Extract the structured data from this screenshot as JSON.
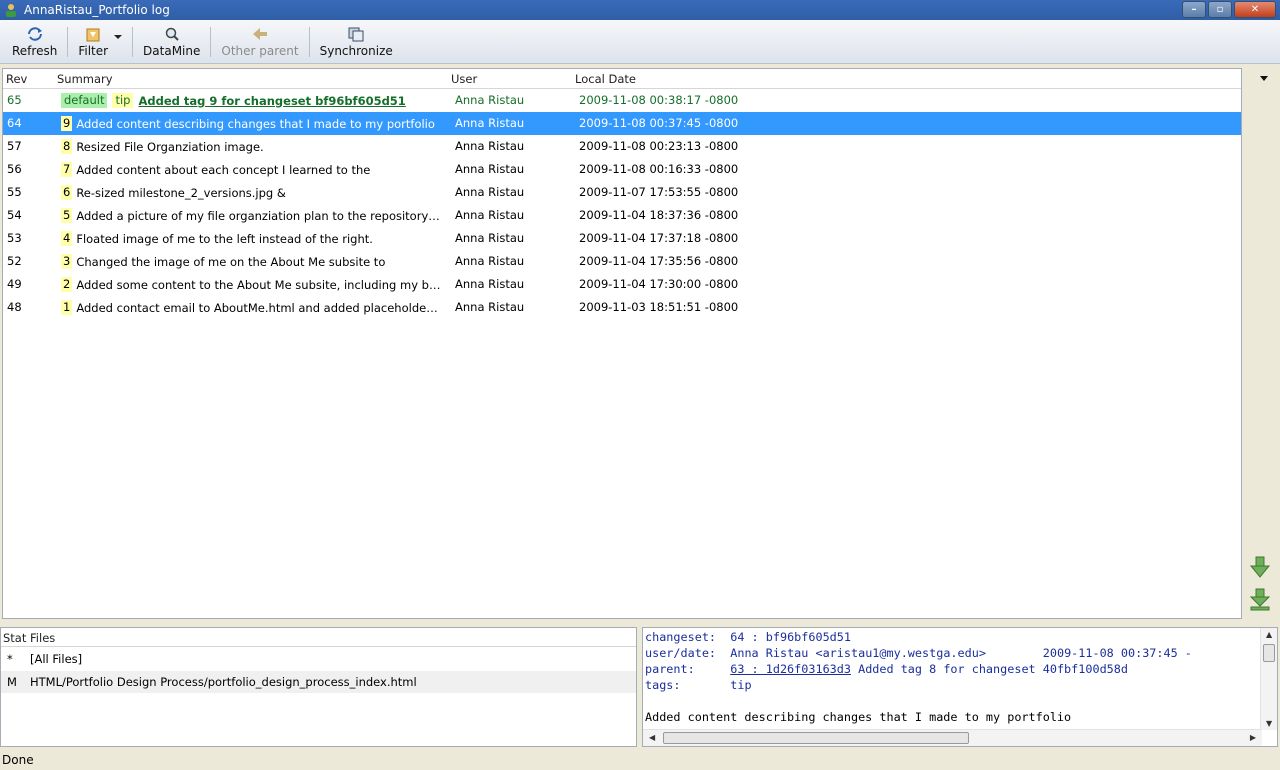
{
  "window": {
    "title": "AnnaRistau_Portfolio log",
    "minimize_icon": "minimize-icon",
    "maximize_icon": "maximize-icon",
    "close_icon": "close-icon"
  },
  "toolbar": {
    "refresh_label": "Refresh",
    "filter_label": "Filter",
    "datamine_label": "DataMine",
    "other_parent_label": "Other parent",
    "synchronize_label": "Synchronize"
  },
  "log": {
    "headers": {
      "rev": "Rev",
      "summary": "Summary",
      "user": "User",
      "date": "Local Date"
    },
    "rows": [
      {
        "rev": "65",
        "branch": "default",
        "tag": "tip",
        "summary": "Added tag 9 for changeset bf96bf605d51",
        "user": "Anna Ristau",
        "date": "2009-11-08 00:38:17 -0800"
      },
      {
        "rev": "64",
        "badge": "9",
        "summary": "Added content describing changes that I made to my portfolio",
        "user": "Anna Ristau",
        "date": "2009-11-08 00:37:45 -0800"
      },
      {
        "rev": "57",
        "badge": "8",
        "summary": "Resized File Organziation image.",
        "user": "Anna Ristau",
        "date": "2009-11-08 00:23:13 -0800"
      },
      {
        "rev": "56",
        "badge": "7",
        "summary": "Added content about each concept I learned to the",
        "user": "Anna Ristau",
        "date": "2009-11-08 00:16:33 -0800"
      },
      {
        "rev": "55",
        "badge": "6",
        "summary": "Re-sized milestone_2_versions.jpg &",
        "user": "Anna Ristau",
        "date": "2009-11-07 17:53:55 -0800"
      },
      {
        "rev": "54",
        "badge": "5",
        "summary": "Added a picture of my file organziation plan to the repository in",
        "user": "Anna Ristau",
        "date": "2009-11-04 18:37:36 -0800"
      },
      {
        "rev": "53",
        "badge": "4",
        "summary": "Floated image of me to the left instead of the right.",
        "user": "Anna Ristau",
        "date": "2009-11-04 17:37:18 -0800"
      },
      {
        "rev": "52",
        "badge": "3",
        "summary": "Changed the image of me on the About Me subsite to",
        "user": "Anna Ristau",
        "date": "2009-11-04 17:35:56 -0800"
      },
      {
        "rev": "49",
        "badge": "2",
        "summary": "Added some content to the About Me subsite, including my backgr...",
        "user": "Anna Ristau",
        "date": "2009-11-04 17:30:00 -0800"
      },
      {
        "rev": "48",
        "badge": "1",
        "summary": "Added contact email to AboutMe.html and added placeholders for",
        "user": "Anna Ristau",
        "date": "2009-11-03 18:51:51 -0800"
      }
    ]
  },
  "stat": {
    "header": "Stat Files",
    "rows": [
      {
        "status": "*",
        "path": "[All Files]"
      },
      {
        "status": "M",
        "path": "HTML/Portfolio Design Process/portfolio_design_process_index.html"
      }
    ]
  },
  "detail": {
    "changeset_label": "changeset:",
    "changeset_value": "64 : bf96bf605d51",
    "userdate_label": "user/date:",
    "userdate_value": "Anna Ristau <aristau1@my.westga.edu>",
    "userdate_date": "2009-11-08 00:37:45 -",
    "parent_label": "parent:",
    "parent_link": "63 : 1d26f03163d3",
    "parent_text": "Added tag 8 for changeset 40fbf100d58d",
    "tags_label": "tags:",
    "tags_value": "tip",
    "message": "Added content describing changes that I made to my portfolio"
  },
  "statusbar": {
    "text": "Done"
  },
  "colors": {
    "selection": "#3399ff",
    "tip_green": "#156f2a",
    "tag_yellow": "#ffffaa",
    "branch_green": "#aaf0aa"
  }
}
